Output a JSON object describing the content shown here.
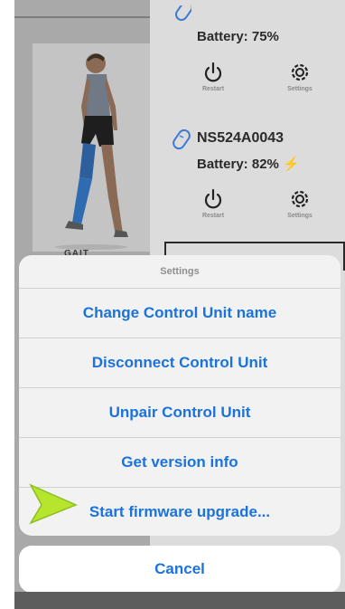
{
  "devices": [
    {
      "name": "",
      "battery": "Battery: 75%",
      "charging": false,
      "restart_label": "Restart",
      "settings_label": "Settings"
    },
    {
      "name": "NS524A0043",
      "battery": "Battery: 82%",
      "charging": true,
      "restart_label": "Restart",
      "settings_label": "Settings"
    }
  ],
  "gait_label": "GAIT",
  "action_sheet": {
    "title": "Settings",
    "items": [
      "Change Control Unit name",
      "Disconnect Control Unit",
      "Unpair Control Unit",
      "Get version info",
      "Start firmware upgrade..."
    ],
    "cancel_label": "Cancel"
  },
  "colors": {
    "accent": "#1a72dd",
    "pointer": "#b7e52d",
    "charging_bolt": "#f2c23a"
  },
  "icons": {
    "device": "sensor-icon",
    "restart": "power-icon",
    "settings": "gear-icon",
    "pointer": "arrow-pointer-icon"
  }
}
